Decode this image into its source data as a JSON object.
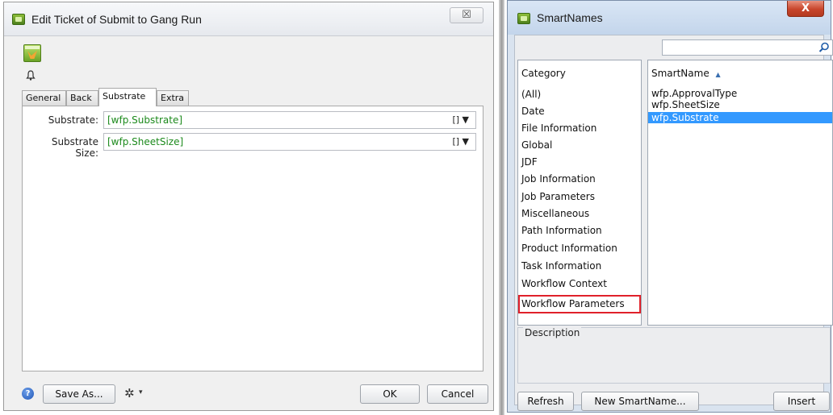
{
  "left_dialog": {
    "title": "Edit Ticket of Submit to Gang Run",
    "close_glyph": "☒",
    "logo_name": "i-cut-product-logo",
    "bell_glyph": "🔔",
    "tabs": [
      {
        "label": "General",
        "active": false
      },
      {
        "label": "Back",
        "active": false
      },
      {
        "label": "Substrate",
        "active": true
      },
      {
        "label": "Extra",
        "active": false
      }
    ],
    "fields": [
      {
        "label": "Substrate:",
        "value": "[wfp.Substrate]",
        "tail": "[] ▼"
      },
      {
        "label": "Substrate Size:",
        "value": "[wfp.SheetSize]",
        "tail": "[] ▼"
      }
    ],
    "footer": {
      "help_glyph": "?",
      "save_as": "Save As...",
      "gear_glyph": "✲",
      "gear_caret": "▾",
      "ok": "OK",
      "cancel": "Cancel"
    }
  },
  "right_dialog": {
    "title": "SmartNames",
    "close_glyph": "X",
    "search": {
      "value": "",
      "placeholder": ""
    },
    "category_header": "Category",
    "categories": [
      "(All)",
      "Date",
      "File Information",
      "Global",
      "JDF",
      "Job Information",
      "Job Parameters",
      "Miscellaneous",
      "Path Information",
      "Product Information",
      "Task Information",
      "Workflow Context",
      "Workflow Parameters"
    ],
    "highlighted_category": "Workflow Parameters",
    "smartname_header": "SmartName",
    "sort_glyph": "▲",
    "smartnames": [
      {
        "label": "wfp.ApprovalType",
        "selected": false
      },
      {
        "label": "wfp.SheetSize",
        "selected": false
      },
      {
        "label": "wfp.Substrate",
        "selected": true
      }
    ],
    "description_label": "Description",
    "buttons": {
      "refresh": "Refresh",
      "new_smartname": "New SmartName...",
      "insert": "Insert"
    },
    "highlight_color": "#e0212a",
    "selection_color": "#3399ff"
  }
}
